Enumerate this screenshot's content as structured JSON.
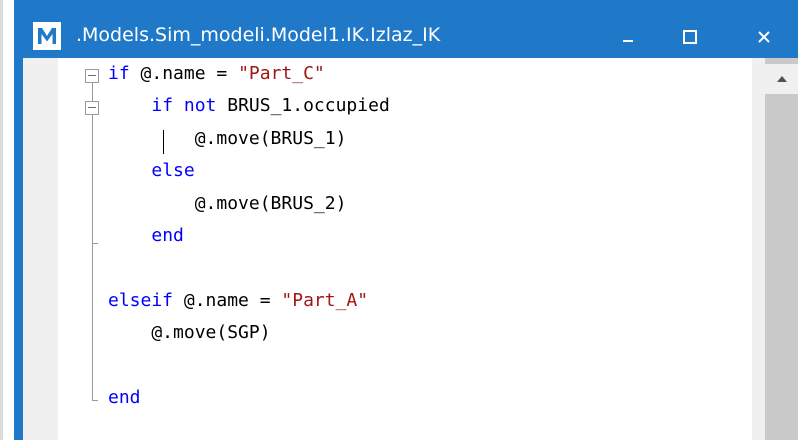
{
  "window": {
    "title": ".Models.Sim_modeli.Model1.IK.Izlaz_IK",
    "app_icon": "M-logo",
    "controls": [
      "minimize-icon",
      "maximize-icon",
      "close-icon"
    ],
    "accent_color": "#1f78c8"
  },
  "editor": {
    "language": "SimTalk",
    "lines": [
      {
        "tokens": [
          {
            "t": "kw",
            "v": "if"
          },
          {
            "t": "plain",
            "v": " @.name = "
          },
          {
            "t": "str",
            "v": "\"Part_C\""
          }
        ]
      },
      {
        "tokens": [
          {
            "t": "plain",
            "v": "    "
          },
          {
            "t": "kw",
            "v": "if not"
          },
          {
            "t": "plain",
            "v": " BRUS_1.occupied"
          }
        ]
      },
      {
        "tokens": [
          {
            "t": "plain",
            "v": "        @.move(BRUS_1)"
          }
        ]
      },
      {
        "tokens": [
          {
            "t": "plain",
            "v": "    "
          },
          {
            "t": "kw",
            "v": "else"
          }
        ]
      },
      {
        "tokens": [
          {
            "t": "plain",
            "v": "        @.move(BRUS_2)"
          }
        ]
      },
      {
        "tokens": [
          {
            "t": "plain",
            "v": "    "
          },
          {
            "t": "kw",
            "v": "end"
          }
        ]
      },
      {
        "tokens": [
          {
            "t": "plain",
            "v": ""
          }
        ]
      },
      {
        "tokens": [
          {
            "t": "kw",
            "v": "elseif"
          },
          {
            "t": "plain",
            "v": " @.name = "
          },
          {
            "t": "str",
            "v": "\"Part_A\""
          }
        ]
      },
      {
        "tokens": [
          {
            "t": "plain",
            "v": "    @.move(SGP)"
          }
        ]
      },
      {
        "tokens": [
          {
            "t": "plain",
            "v": ""
          }
        ]
      },
      {
        "tokens": [
          {
            "t": "kw",
            "v": "end"
          }
        ]
      }
    ],
    "colors": {
      "keyword": "#0000ff",
      "string": "#a31515",
      "text": "#000000"
    }
  },
  "scrollbar": {
    "up_icon": "scroll-up-arrow-icon"
  }
}
